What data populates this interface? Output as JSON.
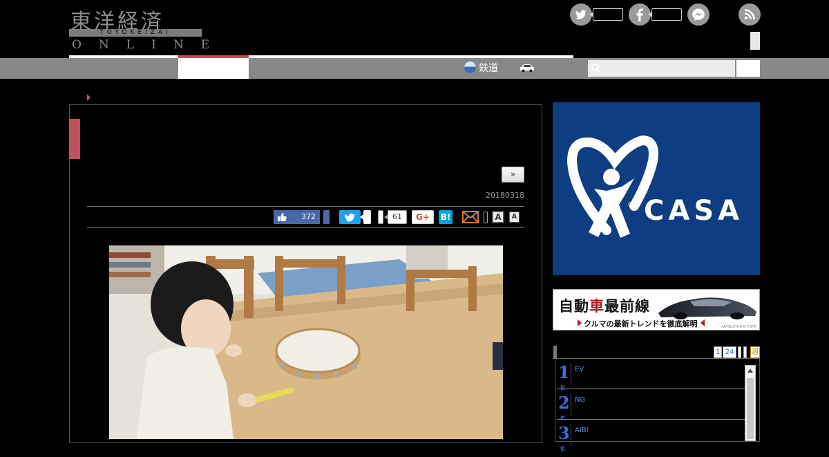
{
  "header": {
    "logo_kanji": "東洋経済",
    "logo_romaji": "TOYOKEIZAI",
    "logo_online": "ONLINE",
    "social": [
      {
        "name": "twitter",
        "glyph": "t",
        "color": "#9a9a9a"
      },
      {
        "name": "facebook",
        "glyph": "f",
        "color": "#9a9a9a"
      },
      {
        "name": "messenger",
        "glyph": "m",
        "color": "#9a9a9a"
      },
      {
        "name": "rss",
        "glyph": "r",
        "color": "#9a9a9a"
      }
    ]
  },
  "nav": {
    "railway_label": "鉄道",
    "railway_icon": "train-icon",
    "car_icon": "car-icon",
    "accent_color": "#c1505b",
    "search": {
      "placeholder": "",
      "icon": "search-icon"
    }
  },
  "article": {
    "next_label": "»",
    "date": "20180318",
    "share": {
      "like_count": "372",
      "gplus_count": "61",
      "gplus_label": "G+",
      "hatena_label": "B!",
      "font_large_label": "A",
      "font_small_label": "A"
    },
    "photo_icon": "photo-toddler-tambourine"
  },
  "sidebar": {
    "ad_casa": {
      "word": "CASA",
      "reg_mark": "®",
      "bg_color": "#0e3d82"
    },
    "banner_auto": {
      "title_a": "自動",
      "title_b": "車",
      "title_c": "最前線",
      "subtitle": "クルマの最新トレンドを徹底解明",
      "credit": "ARTS&STUDIO P.STX"
    },
    "ranking": {
      "tabs": [
        "1",
        "24",
        "",
        "",
        "週"
      ],
      "items": [
        {
          "rank": "1",
          "suffix": "位",
          "title": "EV"
        },
        {
          "rank": "2",
          "suffix": "位",
          "title": "NG"
        },
        {
          "rank": "3",
          "suffix": "位",
          "title": "AIBI"
        }
      ],
      "number_color": "#3b6fd8"
    }
  }
}
